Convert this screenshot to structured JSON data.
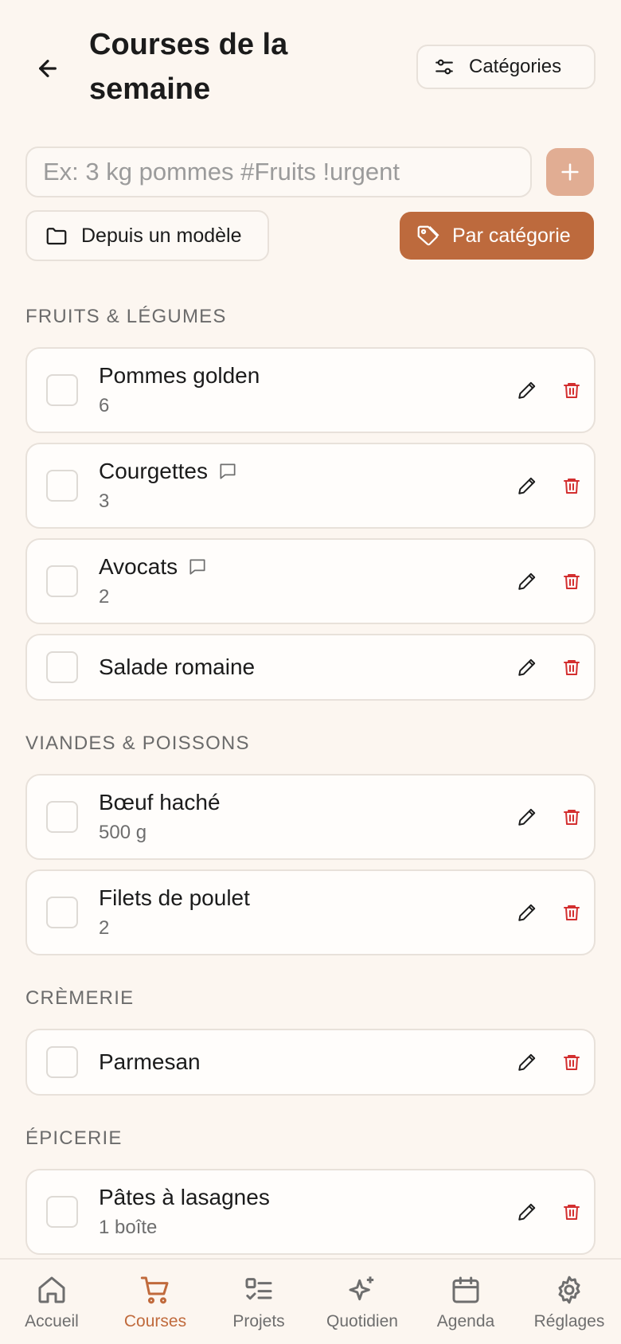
{
  "header": {
    "title": "Courses de la semaine",
    "categories_button": "Catégories"
  },
  "add": {
    "placeholder": "Ex: 3 kg pommes #Fruits !urgent",
    "value": ""
  },
  "actions": {
    "from_template": "Depuis un modèle",
    "by_category": "Par catégorie"
  },
  "colors": {
    "accent": "#bd6a3d",
    "accent_light": "#e1ad93",
    "delete": "#d32f2f",
    "background": "#fcf6f0"
  },
  "sections": [
    {
      "title": "FRUITS & LÉGUMES",
      "items": [
        {
          "name": "Pommes golden",
          "qty": "6",
          "has_note": false
        },
        {
          "name": "Courgettes",
          "qty": "3",
          "has_note": true
        },
        {
          "name": "Avocats",
          "qty": "2",
          "has_note": true
        },
        {
          "name": "Salade romaine",
          "qty": "",
          "has_note": false
        }
      ]
    },
    {
      "title": "VIANDES & POISSONS",
      "items": [
        {
          "name": "Bœuf haché",
          "qty": "500 g",
          "has_note": false
        },
        {
          "name": "Filets de poulet",
          "qty": "2",
          "has_note": false
        }
      ]
    },
    {
      "title": "CRÈMERIE",
      "items": [
        {
          "name": "Parmesan",
          "qty": "",
          "has_note": false
        }
      ]
    },
    {
      "title": "ÉPICERIE",
      "items": [
        {
          "name": "Pâtes à lasagnes",
          "qty": "1 boîte",
          "has_note": false
        }
      ]
    }
  ],
  "nav": {
    "active": "courses",
    "items": [
      {
        "id": "accueil",
        "label": "Accueil",
        "icon": "home-icon"
      },
      {
        "id": "courses",
        "label": "Courses",
        "icon": "cart-icon"
      },
      {
        "id": "projets",
        "label": "Projets",
        "icon": "checklist-icon"
      },
      {
        "id": "quotidien",
        "label": "Quotidien",
        "icon": "sparkles-icon"
      },
      {
        "id": "agenda",
        "label": "Agenda",
        "icon": "calendar-icon"
      },
      {
        "id": "reglages",
        "label": "Réglages",
        "icon": "gear-icon"
      }
    ]
  }
}
